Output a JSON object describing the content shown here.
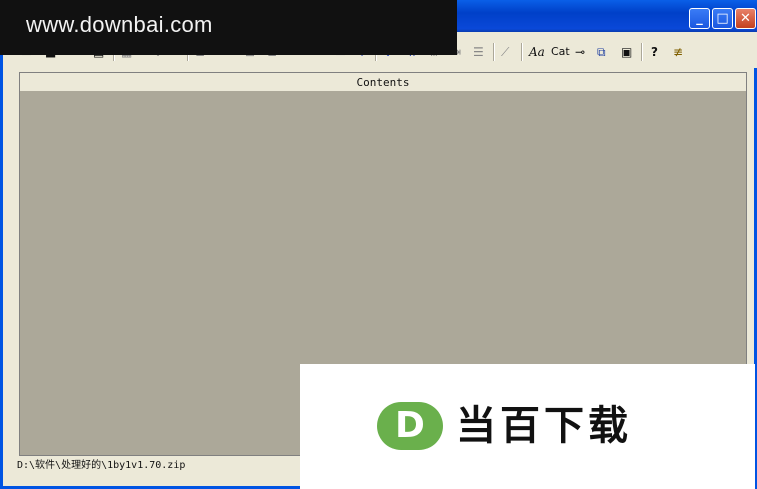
{
  "watermark": {
    "text": "www.downbai.com"
  },
  "titlebar": {
    "minimize_glyph": "_",
    "maximize_glyph": "□",
    "close_glyph": "✕"
  },
  "toolbar": {
    "font_label": "Aa",
    "cat_label": "Cat",
    "help_glyph": "?"
  },
  "content": {
    "header": "Contents"
  },
  "status": {
    "path": "D:\\软件\\处理好的\\1by1v1.70.zip"
  },
  "ad": {
    "logo_letter": "D",
    "text": "当百下载"
  }
}
